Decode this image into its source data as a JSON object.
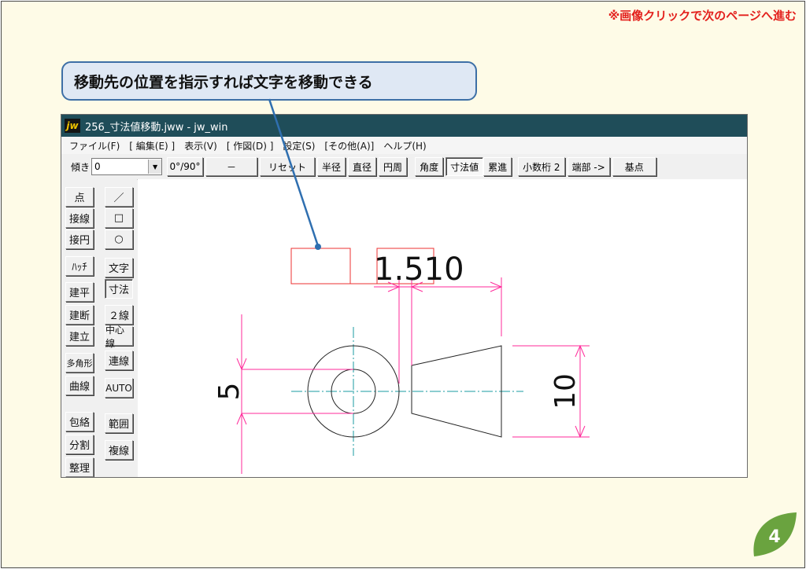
{
  "slide": {
    "top_note": "※画像クリックで次のページへ進む",
    "callout": "移動先の位置を指示すれば文字を移動できる",
    "page_number": "4"
  },
  "window": {
    "title": "256_寸法値移動.jww - jw_win",
    "app_icon": "jw"
  },
  "menu": [
    "ファイル(F)",
    "[ 編集(E) ]",
    "表示(V)",
    "[ 作図(D) ]",
    "設定(S)",
    "[その他(A)]",
    "ヘルプ(H)"
  ],
  "toolbar": {
    "tilt_label": "傾き",
    "tilt_value": "0",
    "angle_button": "0°/90°",
    "dash_button": "－",
    "reset_button": "リセット",
    "radius_button": "半径",
    "diameter_button": "直径",
    "circumference_button": "円周",
    "angle2_button": "角度",
    "dimvalue_button": "寸法値",
    "cumulative_button": "累進",
    "decimal_button": "小数桁 2",
    "endpoint_button": "端部 ->",
    "basepoint_button": "基点"
  },
  "tools_left": [
    "点",
    "接線",
    "接円",
    "ﾊｯﾁ",
    "建平",
    "建断",
    "建立",
    "多角形",
    "曲線",
    "包絡",
    "分割",
    "整理"
  ],
  "tools_right": [
    "／",
    "□",
    "○",
    "文字",
    "寸法",
    "２線",
    "中心線",
    "連線",
    "AUTO",
    "範囲",
    "複線"
  ],
  "drawing": {
    "dim_top": "1.510",
    "dim_left": "5",
    "dim_right": "10"
  },
  "colors": {
    "dim_line": "#ff2a9a",
    "center_line": "#1a9ba0",
    "selection_box": "#ee3030",
    "titlebar": "#1f4d59",
    "callout_border": "#3d6fa6",
    "badge": "#6aa33f"
  }
}
